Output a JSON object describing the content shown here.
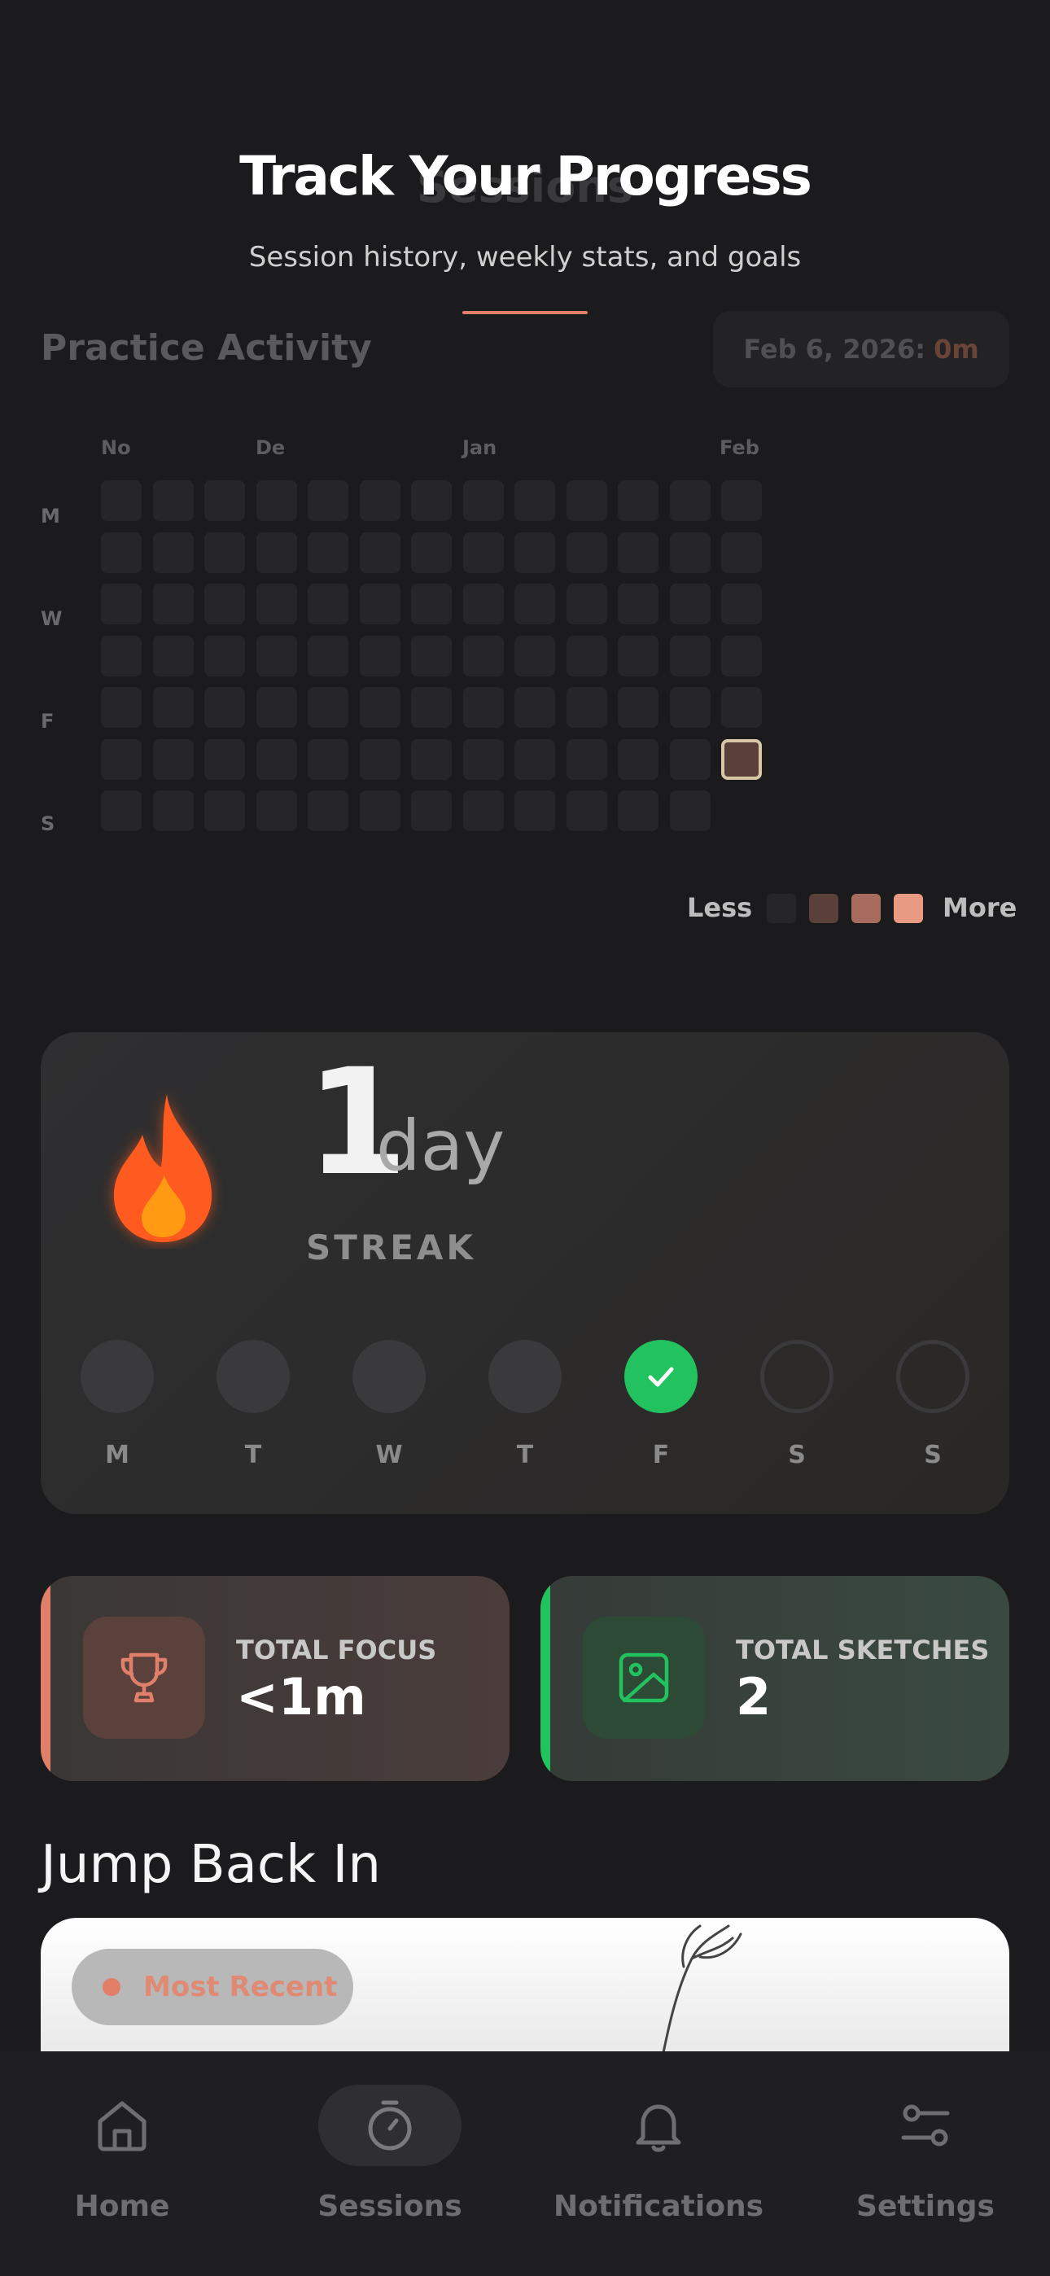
{
  "header": {
    "title": "Track Your Progress",
    "ghost_title": "Sessions",
    "subtitle": "Session history, weekly stats, and goals"
  },
  "activity": {
    "heading": "Practice Activity",
    "date_label": "Feb 6, 2026:",
    "date_value": "0m",
    "months": [
      "No",
      "De",
      "Jan",
      "Feb"
    ],
    "weekdays": [
      "M",
      "W",
      "F",
      "S"
    ],
    "legend_less": "Less",
    "legend_more": "More",
    "legend_colors": [
      "#262628",
      "#5a4039",
      "#a86c5e",
      "#e99a82"
    ]
  },
  "streak": {
    "count": "1",
    "unit": "day",
    "label": "STREAK",
    "days": [
      {
        "label": "M",
        "state": "missed"
      },
      {
        "label": "T",
        "state": "missed"
      },
      {
        "label": "W",
        "state": "missed"
      },
      {
        "label": "T",
        "state": "missed"
      },
      {
        "label": "F",
        "state": "done"
      },
      {
        "label": "S",
        "state": "upcoming"
      },
      {
        "label": "S",
        "state": "upcoming"
      }
    ]
  },
  "stats": {
    "focus": {
      "label": "TOTAL FOCUS",
      "value": "<1m",
      "accent": "#e0806a",
      "icon": "trophy-icon"
    },
    "sketches": {
      "label": "TOTAL SKETCHES",
      "value": "2",
      "accent": "#22c35e",
      "icon": "image-icon"
    }
  },
  "jump": {
    "heading": "Jump Back In",
    "badge": "Most Recent"
  },
  "nav": {
    "items": [
      {
        "label": "Home",
        "icon": "home-icon"
      },
      {
        "label": "Sessions",
        "icon": "stopwatch-icon",
        "active": true
      },
      {
        "label": "Notifications",
        "icon": "bell-icon"
      },
      {
        "label": "Settings",
        "icon": "sliders-icon"
      }
    ]
  }
}
